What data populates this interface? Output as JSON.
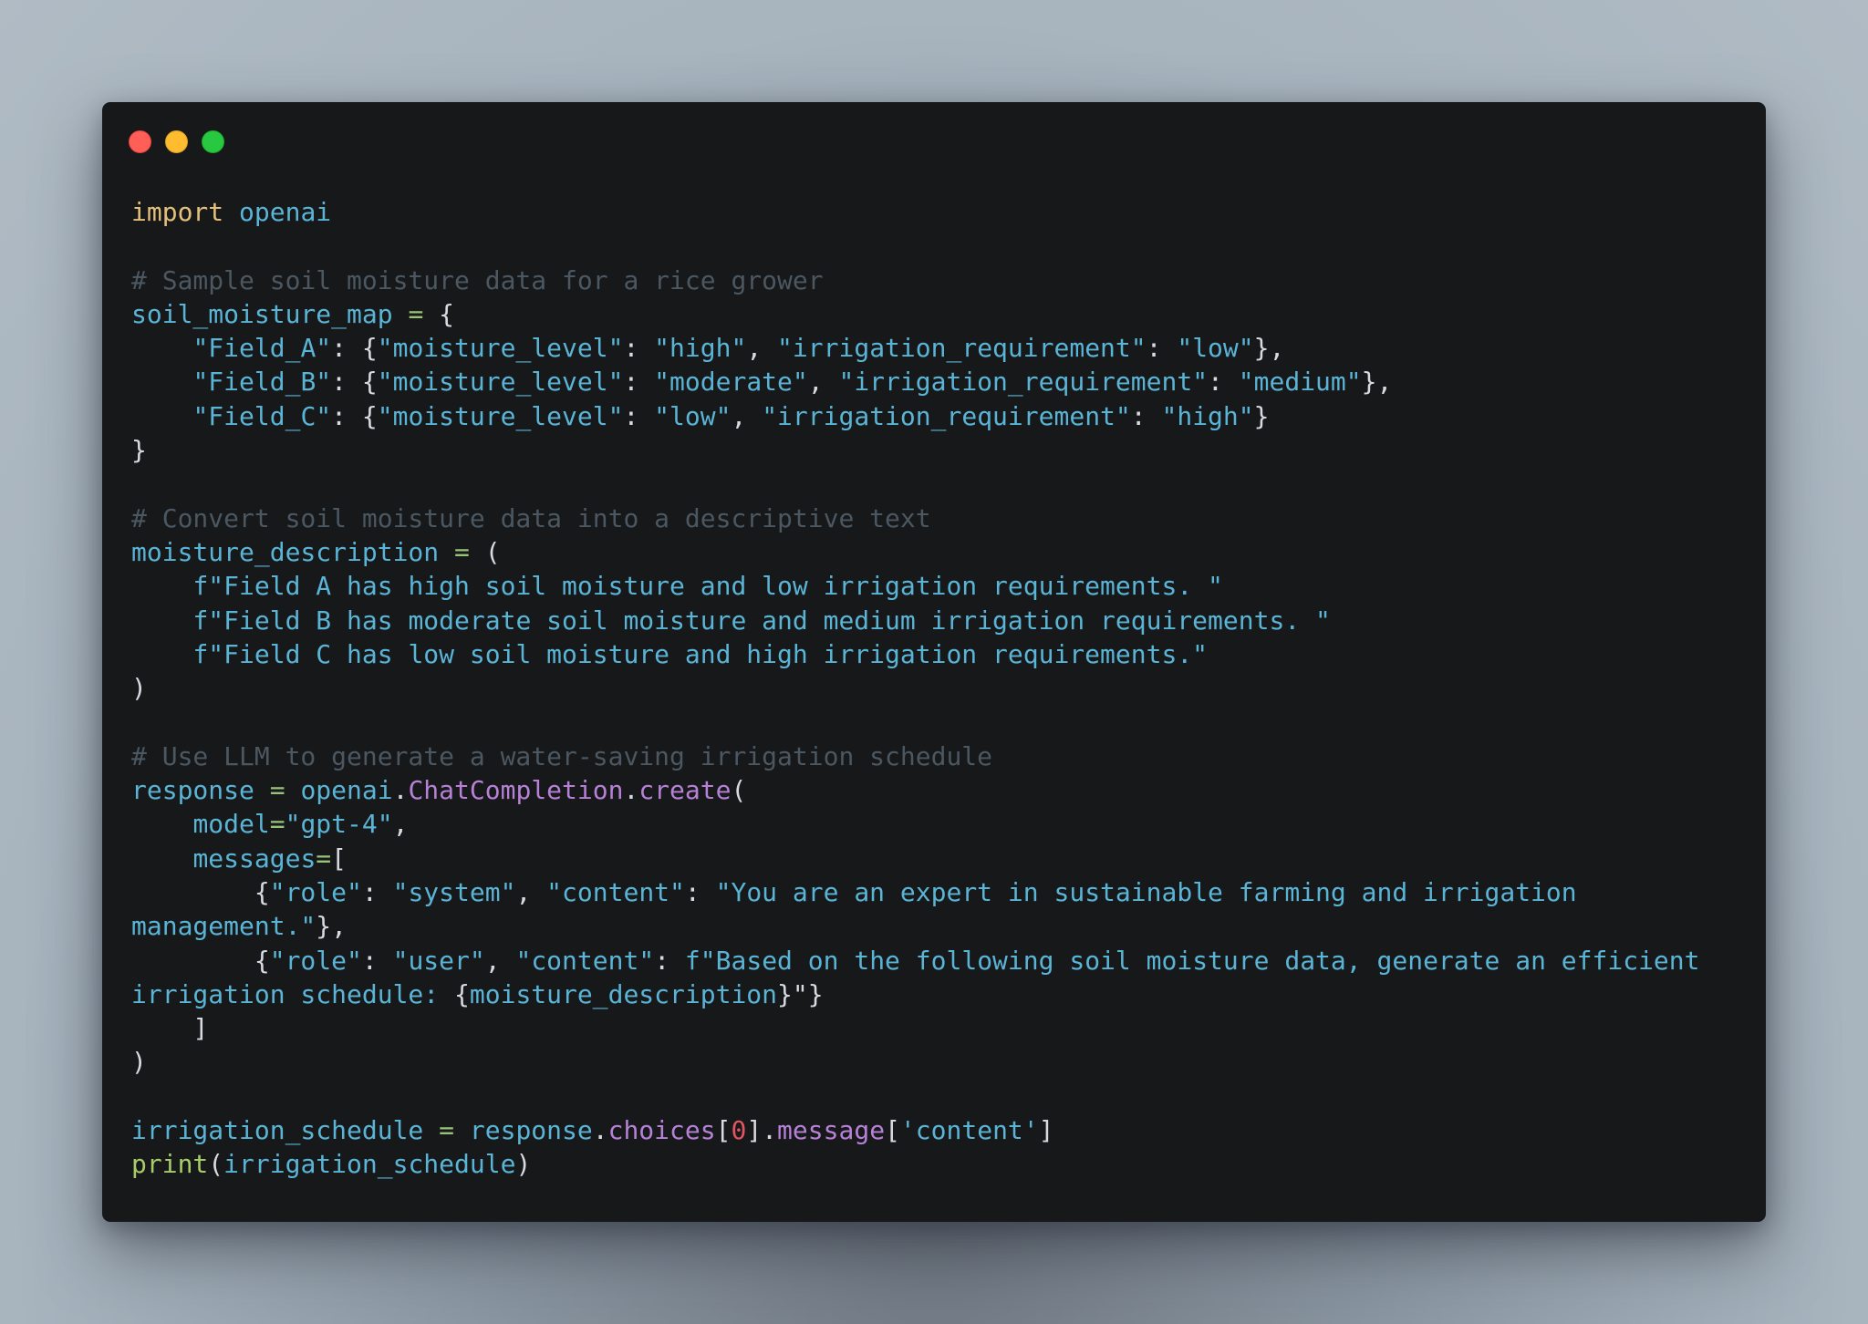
{
  "window": {
    "controls": [
      {
        "name": "close",
        "color": "#ff5f57"
      },
      {
        "name": "minimize",
        "color": "#febc2e"
      },
      {
        "name": "maximize",
        "color": "#28c840"
      }
    ]
  },
  "theme": {
    "background": "#17181a",
    "keyword": "#e5c07b",
    "identifier": "#5ab4d6",
    "comment": "#4b5761",
    "operator": "#98c379",
    "property": "#b681d6",
    "number": "#e0555f",
    "punctuation": "#d7dae0"
  },
  "code": {
    "language": "python",
    "lines": [
      [
        [
          "keyword",
          "import"
        ],
        [
          "plain",
          " "
        ],
        [
          "ident",
          "openai"
        ]
      ],
      [],
      [
        [
          "comment",
          "# Sample soil moisture data for a rice grower"
        ]
      ],
      [
        [
          "ident",
          "soil_moisture_map"
        ],
        [
          "plain",
          " "
        ],
        [
          "op",
          "="
        ],
        [
          "plain",
          " "
        ],
        [
          "punct",
          "{"
        ]
      ],
      [
        [
          "plain",
          "    "
        ],
        [
          "string",
          "\"Field_A\""
        ],
        [
          "punct",
          ": {"
        ],
        [
          "string",
          "\"moisture_level\""
        ],
        [
          "punct",
          ": "
        ],
        [
          "string",
          "\"high\""
        ],
        [
          "punct",
          ", "
        ],
        [
          "string",
          "\"irrigation_requirement\""
        ],
        [
          "punct",
          ": "
        ],
        [
          "string",
          "\"low\""
        ],
        [
          "punct",
          "},"
        ]
      ],
      [
        [
          "plain",
          "    "
        ],
        [
          "string",
          "\"Field_B\""
        ],
        [
          "punct",
          ": {"
        ],
        [
          "string",
          "\"moisture_level\""
        ],
        [
          "punct",
          ": "
        ],
        [
          "string",
          "\"moderate\""
        ],
        [
          "punct",
          ", "
        ],
        [
          "string",
          "\"irrigation_requirement\""
        ],
        [
          "punct",
          ": "
        ],
        [
          "string",
          "\"medium\""
        ],
        [
          "punct",
          "},"
        ]
      ],
      [
        [
          "plain",
          "    "
        ],
        [
          "string",
          "\"Field_C\""
        ],
        [
          "punct",
          ": {"
        ],
        [
          "string",
          "\"moisture_level\""
        ],
        [
          "punct",
          ": "
        ],
        [
          "string",
          "\"low\""
        ],
        [
          "punct",
          ", "
        ],
        [
          "string",
          "\"irrigation_requirement\""
        ],
        [
          "punct",
          ": "
        ],
        [
          "string",
          "\"high\""
        ],
        [
          "punct",
          "}"
        ]
      ],
      [
        [
          "punct",
          "}"
        ]
      ],
      [],
      [
        [
          "comment",
          "# Convert soil moisture data into a descriptive text"
        ]
      ],
      [
        [
          "ident",
          "moisture_description"
        ],
        [
          "plain",
          " "
        ],
        [
          "op",
          "="
        ],
        [
          "plain",
          " "
        ],
        [
          "punct",
          "("
        ]
      ],
      [
        [
          "plain",
          "    "
        ],
        [
          "string",
          "f\"Field A has high soil moisture and low irrigation requirements. \""
        ]
      ],
      [
        [
          "plain",
          "    "
        ],
        [
          "string",
          "f\"Field B has moderate soil moisture and medium irrigation requirements. \""
        ]
      ],
      [
        [
          "plain",
          "    "
        ],
        [
          "string",
          "f\"Field C has low soil moisture and high irrigation requirements.\""
        ]
      ],
      [
        [
          "punct",
          ")"
        ]
      ],
      [],
      [
        [
          "comment",
          "# Use LLM to generate a water-saving irrigation schedule"
        ]
      ],
      [
        [
          "ident",
          "response"
        ],
        [
          "plain",
          " "
        ],
        [
          "op",
          "="
        ],
        [
          "plain",
          " "
        ],
        [
          "ident",
          "openai"
        ],
        [
          "punct",
          "."
        ],
        [
          "prop",
          "ChatCompletion"
        ],
        [
          "punct",
          "."
        ],
        [
          "prop",
          "create"
        ],
        [
          "punct",
          "("
        ]
      ],
      [
        [
          "plain",
          "    "
        ],
        [
          "ident",
          "model"
        ],
        [
          "op",
          "="
        ],
        [
          "string",
          "\"gpt-4\""
        ],
        [
          "punct",
          ","
        ]
      ],
      [
        [
          "plain",
          "    "
        ],
        [
          "ident",
          "messages"
        ],
        [
          "op",
          "="
        ],
        [
          "punct",
          "["
        ]
      ],
      [
        [
          "plain",
          "        "
        ],
        [
          "punct",
          "{"
        ],
        [
          "string",
          "\"role\""
        ],
        [
          "punct",
          ": "
        ],
        [
          "string",
          "\"system\""
        ],
        [
          "punct",
          ", "
        ],
        [
          "string",
          "\"content\""
        ],
        [
          "punct",
          ": "
        ],
        [
          "string",
          "\"You are an expert in sustainable farming and irrigation"
        ]
      ],
      [
        [
          "string",
          "management.\""
        ],
        [
          "punct",
          "},"
        ]
      ],
      [
        [
          "plain",
          "        "
        ],
        [
          "punct",
          "{"
        ],
        [
          "string",
          "\"role\""
        ],
        [
          "punct",
          ": "
        ],
        [
          "string",
          "\"user\""
        ],
        [
          "punct",
          ", "
        ],
        [
          "string",
          "\"content\""
        ],
        [
          "punct",
          ": "
        ],
        [
          "string",
          "f\"Based on the following soil moisture data, generate an efficient"
        ]
      ],
      [
        [
          "string",
          "irrigation schedule: "
        ],
        [
          "punct",
          "{"
        ],
        [
          "ident",
          "moisture_description"
        ],
        [
          "punct",
          "}\"}"
        ]
      ],
      [
        [
          "plain",
          "    "
        ],
        [
          "punct",
          "]"
        ]
      ],
      [
        [
          "punct",
          ")"
        ]
      ],
      [],
      [
        [
          "ident",
          "irrigation_schedule"
        ],
        [
          "plain",
          " "
        ],
        [
          "op",
          "="
        ],
        [
          "plain",
          " "
        ],
        [
          "ident",
          "response"
        ],
        [
          "punct",
          "."
        ],
        [
          "prop",
          "choices"
        ],
        [
          "punct",
          "["
        ],
        [
          "number",
          "0"
        ],
        [
          "punct",
          "]."
        ],
        [
          "prop",
          "message"
        ],
        [
          "punct",
          "["
        ],
        [
          "string",
          "'content'"
        ],
        [
          "punct",
          "]"
        ]
      ],
      [
        [
          "builtin",
          "print"
        ],
        [
          "punct",
          "("
        ],
        [
          "ident",
          "irrigation_schedule"
        ],
        [
          "punct",
          ")"
        ]
      ]
    ]
  }
}
